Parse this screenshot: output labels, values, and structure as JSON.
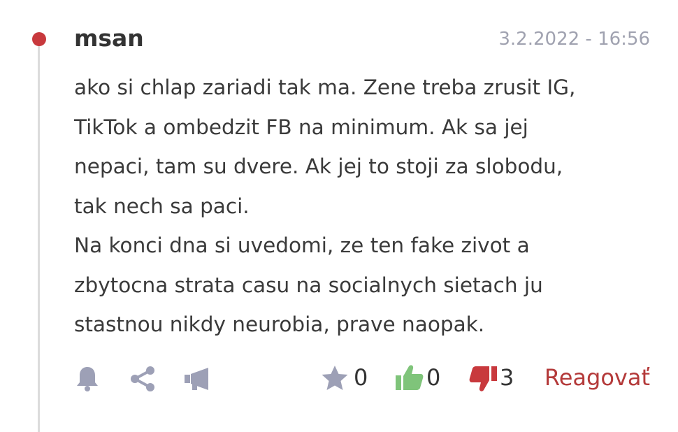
{
  "comment": {
    "author": "msan",
    "timestamp": "3.2.2022 - 16:56",
    "lines": [
      "ako si chlap zariadi tak ma. Zene treba zrusit IG,",
      "TikTok a ombedzit FB na minimum. Ak sa jej",
      "nepaci, tam su dvere. Ak jej to stoji za slobodu,",
      "tak nech sa paci.",
      "Na konci dna si uvedomi, ze ten fake zivot a",
      "zbytocna strata casu na socialnych sietach ju",
      "stastnou nikdy neurobia, prave naopak."
    ]
  },
  "actions": {
    "icons": [
      "bell-icon",
      "share-icon",
      "megaphone-icon"
    ],
    "star_count": "0",
    "like_count": "0",
    "dislike_count": "3",
    "reply_label": "Reagovať"
  },
  "colors": {
    "accent_red": "#c8393d",
    "like_green": "#7fc47a",
    "dislike_red": "#c8393d",
    "icon_gray": "#9da0b6",
    "reply_red": "#b43a3a"
  }
}
